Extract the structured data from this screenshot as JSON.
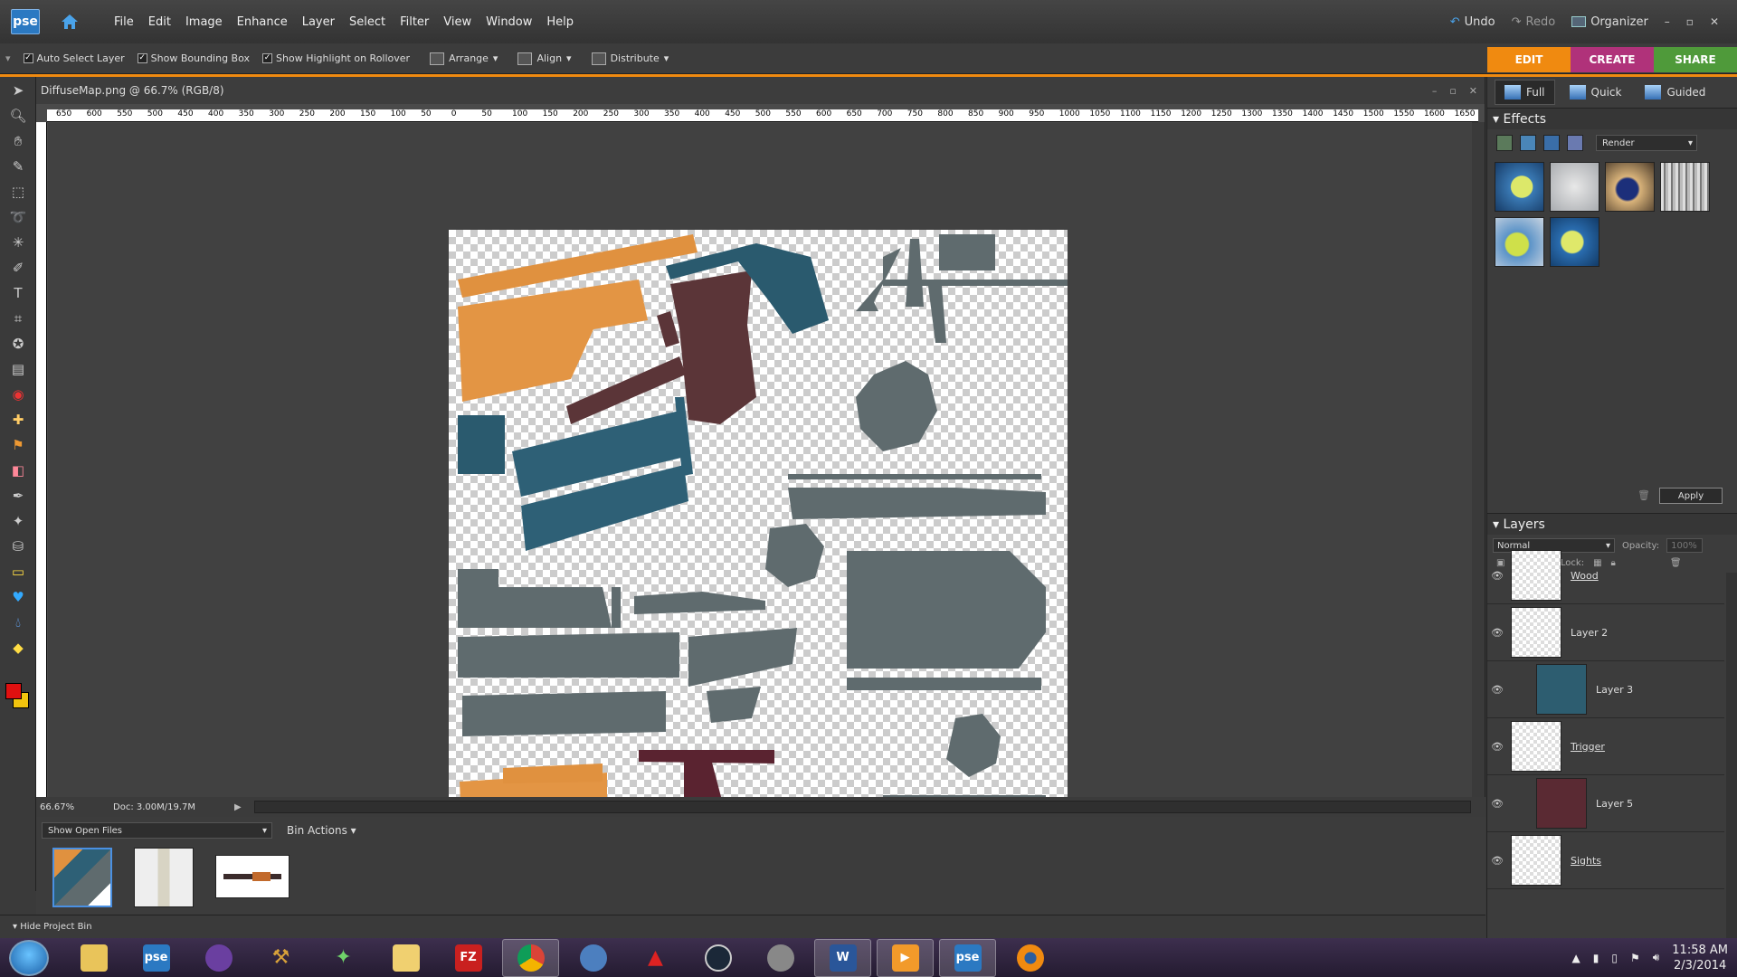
{
  "app": {
    "logo": "pse",
    "home_icon": "home-icon"
  },
  "menu": [
    "File",
    "Edit",
    "Image",
    "Enhance",
    "Layer",
    "Select",
    "Filter",
    "View",
    "Window",
    "Help"
  ],
  "title_actions": {
    "undo": "Undo",
    "redo": "Redo",
    "organizer": "Organizer"
  },
  "options_bar": {
    "auto_select": "Auto Select Layer",
    "bounding_box": "Show Bounding Box",
    "highlight": "Show Highlight on Rollover",
    "arrange": "Arrange",
    "align": "Align",
    "distribute": "Distribute"
  },
  "mode_tabs": [
    {
      "label": "EDIT",
      "color": "#f08a10"
    },
    {
      "label": "CREATE",
      "color": "#b0327a"
    },
    {
      "label": "SHARE",
      "color": "#4f9a3a"
    }
  ],
  "document": {
    "title": "DiffuseMap.png @ 66.7% (RGB/8)",
    "zoom": "66.67%",
    "doc_info": "Doc: 3.00M/19.7M",
    "ruler_h": [
      "650",
      "600",
      "550",
      "500",
      "450",
      "400",
      "350",
      "300",
      "250",
      "200",
      "150",
      "100",
      "50",
      "0",
      "50",
      "100",
      "150",
      "200",
      "250",
      "300",
      "350",
      "400",
      "450",
      "500",
      "550",
      "600",
      "650",
      "700",
      "750",
      "800",
      "850",
      "900",
      "950",
      "1000",
      "1050",
      "1100",
      "1150",
      "1200",
      "1250",
      "1300",
      "1350",
      "1400",
      "1450",
      "1500",
      "1550",
      "1600",
      "1650"
    ]
  },
  "project_bin": {
    "show_select": "Show Open Files",
    "bin_actions": "Bin Actions",
    "hide_label": "Hide Project Bin"
  },
  "right_panel": {
    "subtabs": [
      "Full",
      "Quick",
      "Guided"
    ],
    "effects_title": "Effects",
    "effects_category": "Render",
    "apply": "Apply",
    "layers_title": "Layers",
    "blend_mode": "Normal",
    "opacity_label": "Opacity:",
    "opacity_value": "100%",
    "lock_label": "Lock:",
    "layers": [
      {
        "name": "Wood",
        "thumb": "transparent",
        "underline": true,
        "clipped": false
      },
      {
        "name": "Layer 2",
        "thumb": "transparent",
        "underline": false,
        "clipped": false
      },
      {
        "name": "Layer 3",
        "thumb": "#2d5d70",
        "underline": false,
        "clipped": true
      },
      {
        "name": "Trigger",
        "thumb": "transparent",
        "underline": true,
        "clipped": false
      },
      {
        "name": "Layer 5",
        "thumb": "#5a2a33",
        "underline": false,
        "clipped": true
      },
      {
        "name": "Sights",
        "thumb": "transparent",
        "underline": true,
        "clipped": false
      }
    ]
  },
  "taskbar": {
    "time": "11:58 AM",
    "date": "2/3/2014",
    "apps": [
      "explorer",
      "pse",
      "app-purple",
      "app-gold",
      "app-green",
      "app-move",
      "filezilla",
      "chrome",
      "app-blue",
      "app-red",
      "steam",
      "app-gray",
      "word",
      "app-orange",
      "pse",
      "blender"
    ]
  }
}
